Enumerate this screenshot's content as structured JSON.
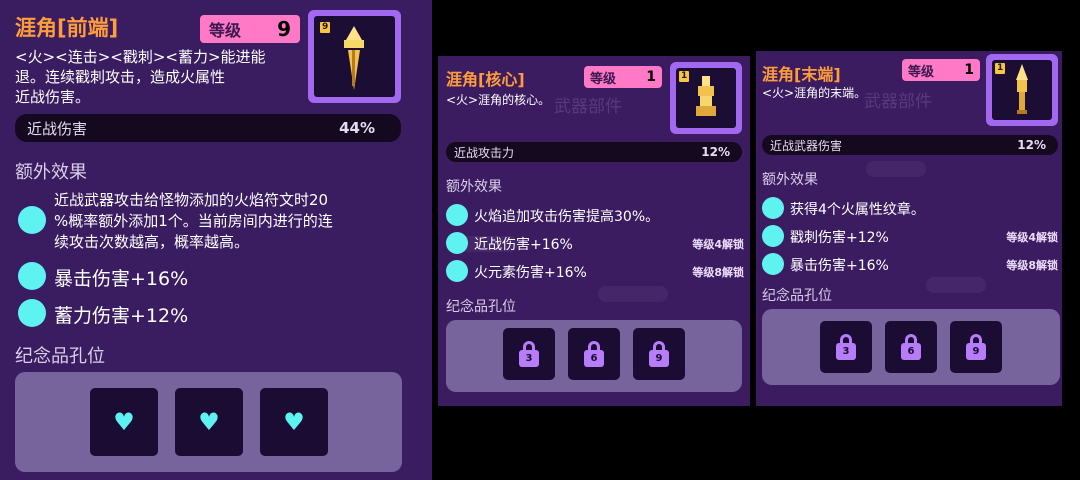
{
  "colors": {
    "accent_orange": "#ff9d3a",
    "level_pink": "#ff79c6",
    "cyan": "#5ef3f0",
    "icon_frame": "#a268ef"
  },
  "card1": {
    "title": "涯角[前端]",
    "level_label": "等级",
    "level_value": "9",
    "tier": "9",
    "icon": "sword-blade-icon",
    "desc": "<火><连击><戳刺><蓄力>能进能\n退。连续戳刺攻击，造成火属性\n近战伤害。",
    "stat_label": "近战伤害",
    "stat_value": "44%",
    "extra_title": "额外效果",
    "effects": [
      {
        "text": "近战武器攻击给怪物添加的火焰符文时20\n%概率额外添加1个。当前房间内进行的连\n续攻击次数越高，概率越高。"
      },
      {
        "text": "暴击伤害+16%"
      },
      {
        "text": "蓄力伤害+12%"
      }
    ],
    "souvenir_title": "纪念品孔位",
    "slots": [
      "heart-icon",
      "heart-icon",
      "heart-icon"
    ]
  },
  "card2": {
    "title": "涯角[核心]",
    "level_label": "等级",
    "level_value": "1",
    "tier": "1",
    "icon": "sword-core-icon",
    "desc": "<火>涯角的核心。",
    "bg_text": "武器部件",
    "stat_label": "近战攻击力",
    "stat_value": "12%",
    "extra_title": "额外效果",
    "effects": [
      {
        "text": "火焰追加攻击伤害提高30%。",
        "lock": ""
      },
      {
        "text": "近战伤害+16%",
        "lock": "等级4解锁"
      },
      {
        "text": "火元素伤害+16%",
        "lock": "等级8解锁"
      }
    ],
    "souvenir_title": "纪念品孔位",
    "slots": [
      "3",
      "6",
      "9"
    ]
  },
  "card3": {
    "title": "涯角[末端]",
    "level_label": "等级",
    "level_value": "1",
    "tier": "1",
    "icon": "sword-hilt-icon",
    "desc": "<火>涯角的末端。",
    "bg_text": "武器部件",
    "stat_label": "近战武器伤害",
    "stat_value": "12%",
    "extra_title": "额外效果",
    "effects": [
      {
        "text": "获得4个火属性纹章。",
        "lock": ""
      },
      {
        "text": "戳刺伤害+12%",
        "lock": "等级4解锁"
      },
      {
        "text": "暴击伤害+16%",
        "lock": "等级8解锁"
      }
    ],
    "souvenir_title": "纪念品孔位",
    "slots": [
      "3",
      "6",
      "9"
    ]
  }
}
